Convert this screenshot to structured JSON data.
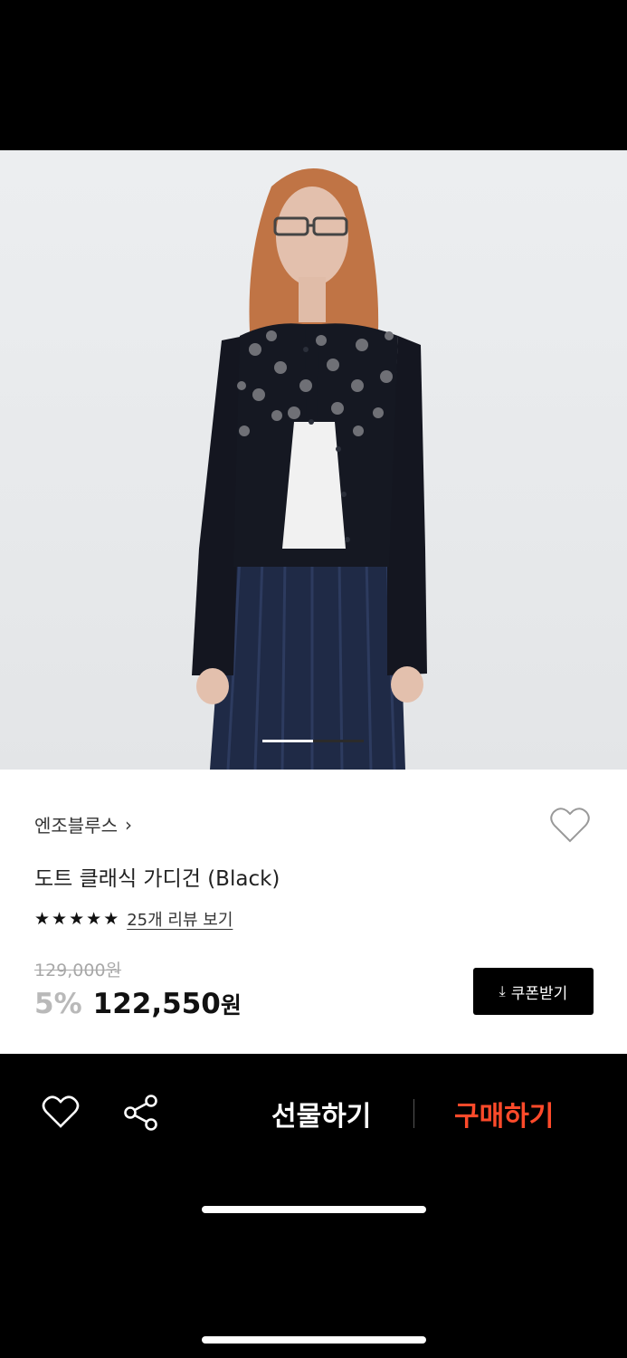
{
  "product": {
    "brand": "엔조블루스",
    "brand_chevron": "›",
    "title": "도트 클래식 가디건 (Black)",
    "rating_stars": 5,
    "review_link": "25개 리뷰 보기",
    "original_price": "129,000원",
    "discount": "5%",
    "sale_price": "122,550",
    "currency": "원",
    "coupon_label": "쿠폰받기",
    "coupon_icon": "download-icon"
  },
  "gallery": {
    "page_index": 1,
    "page_count": 2
  },
  "bottom_bar": {
    "gift_label": "선물하기",
    "buy_label": "구매하기",
    "heart_icon": "heart-icon",
    "share_icon": "share-icon",
    "buy_color": "#ff4a2a"
  }
}
